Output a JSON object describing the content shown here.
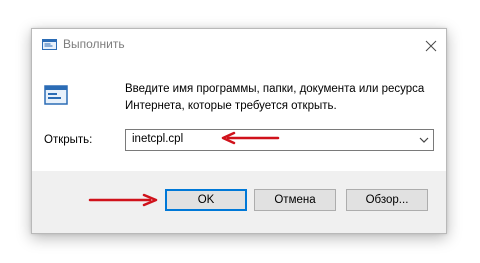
{
  "dialog": {
    "title": "Выполнить",
    "description": "Введите имя программы, папки, документа или ресурса Интернета, которые требуется открыть.",
    "open_label": "Открыть:",
    "open_value": "inetcpl.cpl",
    "buttons": {
      "ok": "OK",
      "cancel": "Отмена",
      "browse": "Обзор..."
    }
  },
  "icons": {
    "title": "run-icon",
    "big": "run-icon",
    "close": "close-icon",
    "dropdown": "chevron-down-icon"
  },
  "colors": {
    "annotation_arrow": "#d0121b",
    "accent": "#0078d7",
    "footer_bg": "#f0f0f0"
  }
}
